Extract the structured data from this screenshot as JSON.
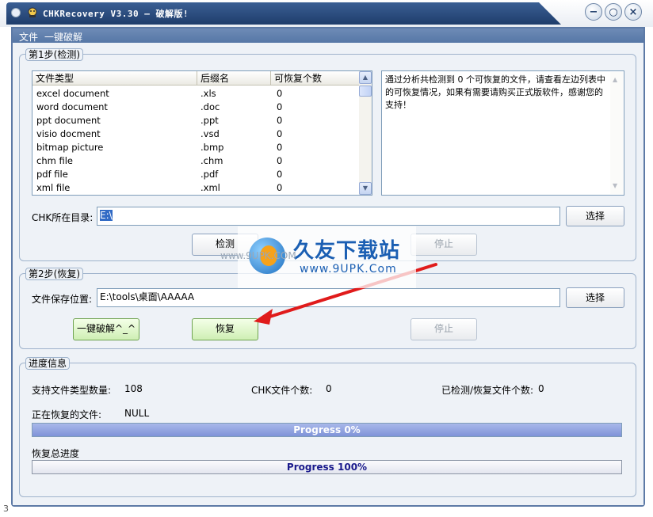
{
  "window": {
    "title": "CHKRecovery V3.30 — 破解版!",
    "buttons": {
      "minimize": "−",
      "restore": "○",
      "close": "×"
    }
  },
  "menu": {
    "items": [
      "文件",
      "一键破解"
    ]
  },
  "step1": {
    "legend": "第1步(检测)",
    "columns": [
      "文件类型",
      "后缀名",
      "可恢复个数"
    ],
    "rows": [
      {
        "type": "excel document",
        "ext": ".xls",
        "count": "0"
      },
      {
        "type": "word document",
        "ext": ".doc",
        "count": "0"
      },
      {
        "type": "ppt document",
        "ext": ".ppt",
        "count": "0"
      },
      {
        "type": "visio docment",
        "ext": ".vsd",
        "count": "0"
      },
      {
        "type": "bitmap picture",
        "ext": ".bmp",
        "count": "0"
      },
      {
        "type": "chm file",
        "ext": ".chm",
        "count": "0"
      },
      {
        "type": "pdf file",
        "ext": ".pdf",
        "count": "0"
      },
      {
        "type": "xml file",
        "ext": ".xml",
        "count": "0"
      }
    ],
    "info_text": "通过分析共检测到 0 个可恢复的文件，请查看左边列表中的可恢复情况，如果有需要请购买正式版软件，感谢您的支持！",
    "dir_label": "CHK所在目录:",
    "dir_value": "E:\\",
    "browse_label": "选择",
    "detect_label": "检测",
    "stop_label": "停止"
  },
  "step2": {
    "legend": "第2步(恢复)",
    "save_label": "文件保存位置:",
    "save_value": "E:\\tools\\桌面\\AAAAA",
    "browse_label": "选择",
    "crack_label": "一键破解^_^",
    "recover_label": "恢复",
    "stop_label": "停止"
  },
  "progress": {
    "legend": "进度信息",
    "supported_label": "支持文件类型数量:",
    "supported_value": "108",
    "chk_count_label": "CHK文件个数:",
    "chk_count_value": "0",
    "detected_label": "已检测/恢复文件个数:",
    "detected_value": "0",
    "current_label": "正在恢复的文件:",
    "current_value": "NULL",
    "progress1_text": "Progress 0%",
    "progress1_value": 0,
    "total_label": "恢复总进度",
    "progress2_text": "Progress 100%",
    "progress2_value": 100
  },
  "watermark": {
    "big": "久友下载站",
    "small": "www.9UPK.Com",
    "gray": "www.9UPK.COM"
  },
  "corner_label": "3"
}
